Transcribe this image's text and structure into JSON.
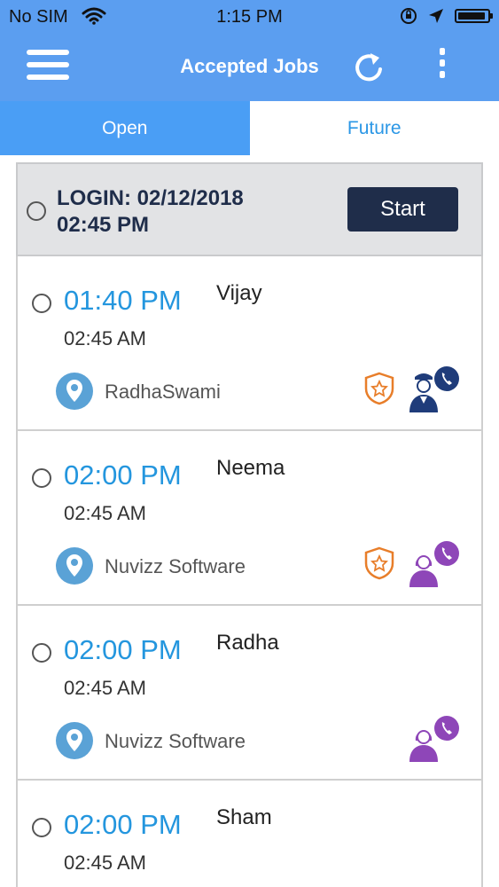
{
  "status": {
    "carrier": "No SIM",
    "time": "1:15 PM"
  },
  "header": {
    "title": "Accepted Jobs",
    "icons": [
      "menu-icon",
      "refresh-icon",
      "more-vertical-icon"
    ]
  },
  "tabs": [
    {
      "label": "Open",
      "active": true
    },
    {
      "label": "Future",
      "active": false
    }
  ],
  "login": {
    "line1": "LOGIN: 02/12/2018",
    "line2": "02:45 PM",
    "button": "Start"
  },
  "jobs": [
    {
      "time": "01:40 PM",
      "name": "Vijay",
      "end": "02:45 AM",
      "location": "RadhaSwami",
      "has_badge": true,
      "person": "officer"
    },
    {
      "time": "02:00 PM",
      "name": "Neema",
      "end": "02:45 AM",
      "location": "Nuvizz Software",
      "has_badge": true,
      "person": "female"
    },
    {
      "time": "02:00 PM",
      "name": "Radha",
      "end": "02:45 AM",
      "location": "Nuvizz Software",
      "has_badge": false,
      "person": "female"
    },
    {
      "time": "02:00 PM",
      "name": "Sham",
      "end": "02:45 AM",
      "location": "",
      "has_badge": false,
      "person": ""
    }
  ],
  "colors": {
    "header_bg": "#5b9ef0",
    "accent_blue": "#2496de",
    "start_button": "#1f2d4a",
    "badge_orange": "#e87e2a",
    "officer_navy": "#1f3c7a",
    "female_purple": "#8e46b8"
  }
}
